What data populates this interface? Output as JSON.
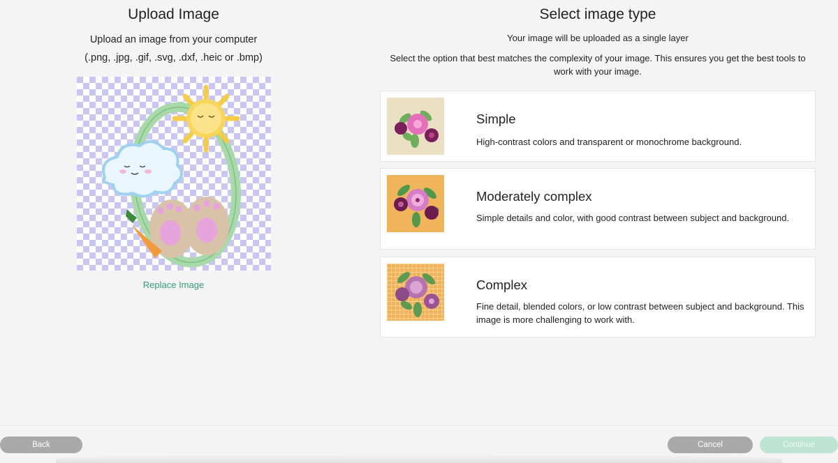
{
  "upload": {
    "title": "Upload Image",
    "subtitle": "Upload an image from your computer",
    "formats": "(.png, .jpg, .gif, .svg, .dxf, .heic or .bmp)",
    "replace_label": "Replace Image"
  },
  "select": {
    "title": "Select image type",
    "layer_note": "Your image will be uploaded as a single layer",
    "instructions": "Select the option that best matches the complexity of your image. This ensures you get the best tools to work with your image."
  },
  "options": [
    {
      "title": "Simple",
      "description": "High-contrast colors and transparent or monochrome background.",
      "thumb_bg": "#ece0c4"
    },
    {
      "title": "Moderately complex",
      "description": "Simple details and color, with good contrast between subject and background.",
      "thumb_bg": "#f0b45a"
    },
    {
      "title": "Complex",
      "description": "Fine detail, blended colors, or low contrast between subject and background. This image is more challenging to work with.",
      "thumb_bg": "#f3b258"
    }
  ],
  "footer": {
    "back_label": "Back",
    "cancel_label": "Cancel",
    "continue_label": "Continue"
  },
  "colors": {
    "accent": "#2f9e72",
    "continue_disabled": "#bfe3d3",
    "button_gray": "#a9a9a9",
    "checker": "#c9c6f4"
  }
}
